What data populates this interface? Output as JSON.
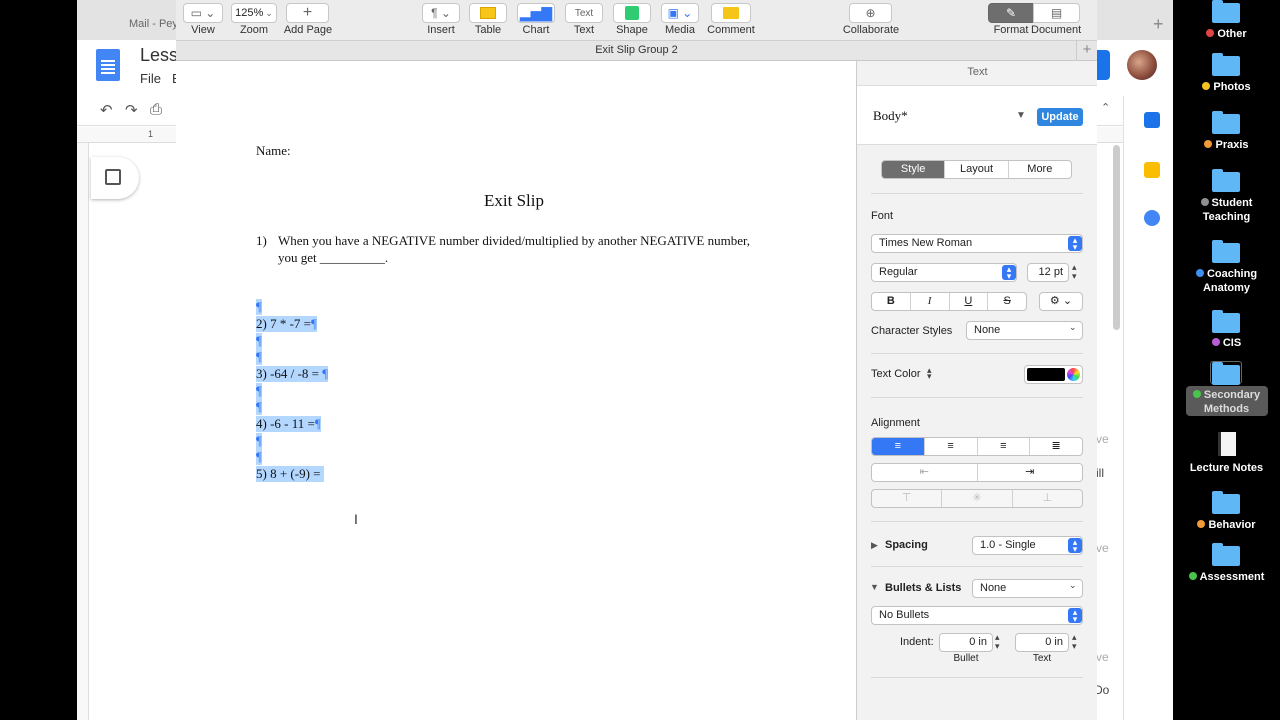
{
  "background_app": {
    "tab_text": "Mail - Peyt",
    "title": "Lesso",
    "menu_file": "File",
    "menu_edit": "E",
    "ruler_mark": "1",
    "side_fragments": [
      "ve",
      "ill",
      "ve",
      "ve",
      "Do"
    ]
  },
  "toolbar": {
    "view_label": "View",
    "zoom_value": "125%",
    "zoom_label": "Zoom",
    "add_page_label": "Add Page",
    "insert_label": "Insert",
    "table_label": "Table",
    "chart_label": "Chart",
    "text_label": "Text",
    "text_button": "Text",
    "shape_label": "Shape",
    "media_label": "Media",
    "comment_label": "Comment",
    "collaborate_label": "Collaborate",
    "format_label": "Format",
    "document_label": "Document"
  },
  "document_title": "Exit Slip Group 2",
  "document": {
    "name_line": "Name:",
    "heading": "Exit Slip",
    "q1_num": "1)",
    "q1_line1": "When you have a NEGATIVE number divided/multiplied by another NEGATIVE number,",
    "q1_line2": "you get __________.",
    "pilcrow": "¶",
    "q2": "2) 7 * -7 =",
    "q3": "3) -64 / -8 = ",
    "q4": "4) -6 - 11 =",
    "q5": "5) 8 + (-9) = "
  },
  "inspector": {
    "title": "Text",
    "paragraph_style": "Body*",
    "update_button": "Update",
    "tabs": [
      "Style",
      "Layout",
      "More"
    ],
    "font_heading": "Font",
    "font_family": "Times New Roman",
    "font_typeface": "Regular",
    "font_size": "12 pt",
    "bold": "B",
    "italic": "I",
    "underline": "U",
    "strikethrough": "S",
    "character_styles_label": "Character Styles",
    "character_styles_value": "None",
    "text_color_label": "Text Color",
    "text_color": "#000000",
    "alignment_heading": "Alignment",
    "spacing_label": "Spacing",
    "spacing_value": "1.0 - Single",
    "bullets_label": "Bullets & Lists",
    "bullets_value": "None",
    "bullets_type": "No Bullets",
    "indent_label": "Indent:",
    "indent_bullet_value": "0 in",
    "indent_text_value": "0 in",
    "indent_bullet_label": "Bullet",
    "indent_text_label": "Text"
  },
  "desktop": {
    "items": [
      {
        "label": "Other",
        "dot": "#e04444"
      },
      {
        "label": "Photos",
        "dot": "#f2c322"
      },
      {
        "label": "Praxis",
        "dot": "#f29a38"
      },
      {
        "label": "Student",
        "label2": "Teaching",
        "dot": "#8e8e93"
      },
      {
        "label": "Coaching",
        "label2": "Anatomy",
        "dot": "#3d8ff0"
      },
      {
        "label": "CIS",
        "dot": "#b95fd6"
      },
      {
        "label": "Secondary",
        "label2": "Methods",
        "dot": "#48c34b"
      },
      {
        "label": "Lecture Notes"
      },
      {
        "label": "Behavior",
        "dot": "#f29a38"
      },
      {
        "label": "Assessment",
        "dot": "#48c34b"
      }
    ]
  }
}
